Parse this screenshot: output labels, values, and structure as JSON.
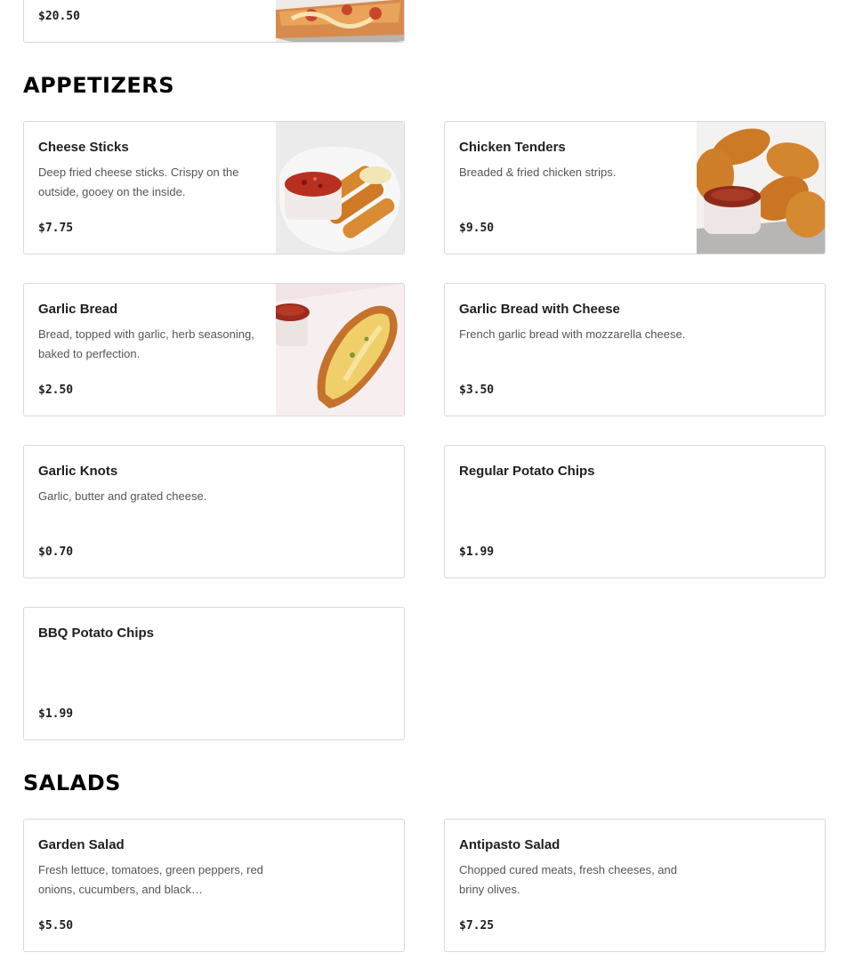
{
  "prev_card": {
    "price": "$20.50"
  },
  "sections": [
    {
      "title": "APPETIZERS",
      "items": [
        {
          "name": "Cheese Sticks",
          "description": "Deep fried cheese sticks. Crispy on the outside, gooey on the inside.",
          "price": "$7.75",
          "has_image": true
        },
        {
          "name": "Chicken Tenders",
          "description": "Breaded & fried chicken strips.",
          "price": "$9.50",
          "has_image": true
        },
        {
          "name": "Garlic Bread",
          "description": "Bread, topped with garlic, herb seasoning, baked to perfection.",
          "price": "$2.50",
          "has_image": true
        },
        {
          "name": "Garlic Bread with Cheese",
          "description": "French garlic bread with mozzarella cheese.",
          "price": "$3.50",
          "has_image": false
        },
        {
          "name": "Garlic Knots",
          "description": "Garlic, butter and grated cheese.",
          "price": "$0.70",
          "has_image": false
        },
        {
          "name": "Regular Potato Chips",
          "description": "",
          "price": "$1.99",
          "has_image": false
        },
        {
          "name": "BBQ Potato Chips",
          "description": "",
          "price": "$1.99",
          "has_image": false
        }
      ]
    },
    {
      "title": "SALADS",
      "items": [
        {
          "name": "Garden Salad",
          "description": "Fresh lettuce, tomatoes, green peppers, red onions, cucumbers, and black…",
          "price": "$5.50",
          "has_image": false
        },
        {
          "name": "Antipasto Salad",
          "description": "Chopped cured meats, fresh cheeses, and briny olives.",
          "price": "$7.25",
          "has_image": false
        }
      ]
    }
  ]
}
